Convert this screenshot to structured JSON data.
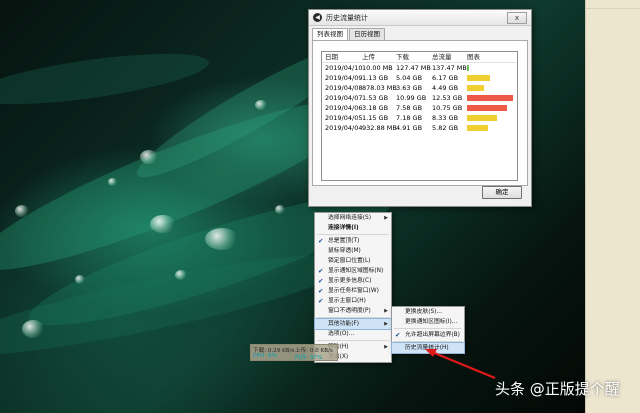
{
  "window": {
    "title": "历史流量统计",
    "tabs": [
      {
        "label": "列表视图",
        "active": true
      },
      {
        "label": "日历视图",
        "active": false
      }
    ],
    "close_glyph": "x",
    "ok_label": "确定",
    "table": {
      "headers": [
        "日期",
        "上传",
        "下载",
        "总流量",
        "图表"
      ],
      "rows": [
        {
          "date": "2019/04/10",
          "up": "10.00 MB",
          "down": "127.47 MB",
          "total": "137.47 MB",
          "bar_fraction": 0.011,
          "bar_color": "#72c05a"
        },
        {
          "date": "2019/04/09",
          "up": "1.13 GB",
          "down": "5.04 GB",
          "total": "6.17 GB",
          "bar_fraction": 0.49,
          "bar_color": "#f0d030"
        },
        {
          "date": "2019/04/08",
          "up": "878.03 MB",
          "down": "3.63 GB",
          "total": "4.49 GB",
          "bar_fraction": 0.36,
          "bar_color": "#f0d030"
        },
        {
          "date": "2019/04/07",
          "up": "1.53 GB",
          "down": "10.99 GB",
          "total": "12.53 GB",
          "bar_fraction": 1.0,
          "bar_color": "#ee5a46"
        },
        {
          "date": "2019/04/06",
          "up": "3.18 GB",
          "down": "7.58 GB",
          "total": "10.75 GB",
          "bar_fraction": 0.86,
          "bar_color": "#ee5a46"
        },
        {
          "date": "2019/04/05",
          "up": "1.15 GB",
          "down": "7.18 GB",
          "total": "8.33 GB",
          "bar_fraction": 0.66,
          "bar_color": "#f0d030"
        },
        {
          "date": "2019/04/04",
          "up": "932.88 MB",
          "down": "4.91 GB",
          "total": "5.82 GB",
          "bar_fraction": 0.46,
          "bar_color": "#f0d030"
        }
      ]
    }
  },
  "context_menu": {
    "items": [
      {
        "label": "选择网络连接(S)",
        "checked": false,
        "submenu": true,
        "bold": false
      },
      {
        "label": "连接详情(I)",
        "checked": false,
        "submenu": false,
        "bold": true
      },
      {
        "label": "总是置顶(T)",
        "checked": true,
        "submenu": false,
        "bold": false
      },
      {
        "label": "鼠标穿透(M)",
        "checked": false,
        "submenu": false,
        "bold": false
      },
      {
        "label": "锁定窗口位置(L)",
        "checked": false,
        "submenu": false,
        "bold": false
      },
      {
        "label": "显示通知区域图标(N)",
        "checked": true,
        "submenu": false,
        "bold": false
      },
      {
        "label": "显示更多信息(C)",
        "checked": true,
        "submenu": false,
        "bold": false
      },
      {
        "label": "显示任务栏窗口(W)",
        "checked": true,
        "submenu": false,
        "bold": false
      },
      {
        "label": "显示主窗口(H)",
        "checked": true,
        "submenu": false,
        "bold": false
      },
      {
        "label": "窗口不透明度(P)",
        "checked": false,
        "submenu": true,
        "bold": false
      },
      {
        "label": "其他功能(F)",
        "checked": false,
        "submenu": true,
        "bold": false,
        "highlighted": true
      },
      {
        "label": "选项(O)...",
        "checked": false,
        "submenu": false,
        "bold": false
      },
      {
        "label": "帮助(H)",
        "checked": false,
        "submenu": true,
        "bold": false
      },
      {
        "label": "退出(X)",
        "checked": false,
        "submenu": false,
        "bold": false
      }
    ]
  },
  "submenu": {
    "items": [
      {
        "label": "更换皮肤(S)...",
        "checked": false,
        "highlighted": false
      },
      {
        "label": "更换通知区图标(I)...",
        "checked": false,
        "highlighted": false
      },
      {
        "label": "允许超出屏幕边界(B)",
        "checked": true,
        "highlighted": false
      },
      {
        "label": "历史流量统计(H)",
        "checked": false,
        "highlighted": true
      }
    ]
  },
  "widget": {
    "upload": "上传: 0.0 KB/s",
    "download": "下载: 0.29 KB/s",
    "cpu": "CPU: 8%",
    "memory": "内存: 37%"
  },
  "watermark": "头条 @正版提个醒",
  "colors": {
    "accent_red": "#e01818",
    "check_blue": "#1a4f9c"
  }
}
